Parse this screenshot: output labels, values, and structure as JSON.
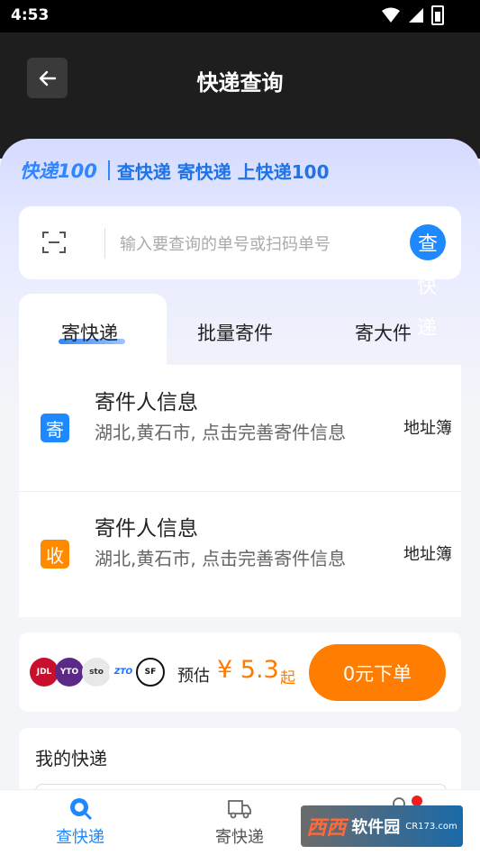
{
  "status_bar": {
    "time": "4:53"
  },
  "header": {
    "title": "快递查询",
    "back_icon": "arrow-left-icon"
  },
  "brand": {
    "logo": "快递100",
    "slogan": "查快递 寄快递 上快递100"
  },
  "search": {
    "placeholder": "输入要查询的单号或扫码单号",
    "value": "",
    "query_button": "查",
    "query_rest": [
      "快",
      "递"
    ]
  },
  "tabs": [
    {
      "label": "寄快递",
      "active": true
    },
    {
      "label": "批量寄件",
      "active": false
    },
    {
      "label": "寄大件",
      "active": false
    }
  ],
  "sender": {
    "badge": "寄",
    "badge_color": "#1e88ff",
    "title": "寄件人信息",
    "subtitle": "湖北,黄石市, 点击完善寄件信息",
    "link": "地址簿"
  },
  "receiver": {
    "badge": "收",
    "badge_color": "#ff8a00",
    "title": "寄件人信息",
    "subtitle": "湖北,黄石市, 点击完善寄件信息",
    "link": "地址簿"
  },
  "price": {
    "carriers": [
      "JDL",
      "YTO",
      "sto",
      "ZTO",
      "SF"
    ],
    "estimate_label": "预估",
    "price": "¥ 5.3",
    "price_suffix": "起",
    "order_button": "0元下单",
    "accent_color": "#ff7d00"
  },
  "my_express": {
    "title": "我的快递"
  },
  "bottom_nav": [
    {
      "label": "查快递",
      "icon": "search-icon",
      "active": true
    },
    {
      "label": "寄快递",
      "icon": "truck-icon",
      "active": false
    }
  ],
  "watermark": {
    "logo": "西西",
    "text": "软件园",
    "domain": "CR173.com"
  }
}
